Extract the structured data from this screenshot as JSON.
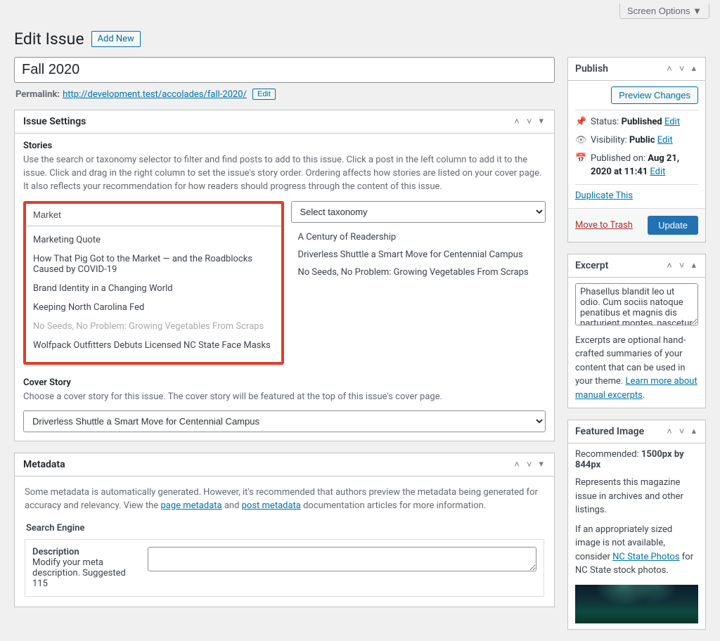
{
  "screen_options_label": "Screen Options ▼",
  "page_title": "Edit Issue",
  "add_new_label": "Add New",
  "title_value": "Fall 2020",
  "permalink": {
    "label": "Permalink:",
    "url": "http://development.test/accolades/fall-2020/",
    "edit_label": "Edit"
  },
  "issue_settings": {
    "heading": "Issue Settings",
    "stories_label": "Stories",
    "stories_help": "Use the search or taxonomy selector to filter and find posts to add to this issue. Click a post in the left column to add it to the issue. Click and drag in the right column to set the issue's story order. Ordering affects how stories are listed on your cover page. It also reflects your recommendation for how readers should progress through the content of this issue.",
    "search_value": "Market",
    "results": [
      {
        "title": "Marketing Quote",
        "muted": false
      },
      {
        "title": "How That Pig Got to the Market — and the Roadblocks Caused by COVID-19",
        "muted": false
      },
      {
        "title": "Brand Identity in a Changing World",
        "muted": false
      },
      {
        "title": "Keeping North Carolina Fed",
        "muted": false
      },
      {
        "title": "No Seeds, No Problem: Growing Vegetables From Scraps",
        "muted": true
      },
      {
        "title": "Wolfpack Outfitters Debuts Licensed NC State Face Masks",
        "muted": false
      }
    ],
    "taxonomy_placeholder": "Select taxonomy",
    "added_stories": [
      "A Century of Readership",
      "Driverless Shuttle a Smart Move for Centennial Campus",
      "No Seeds, No Problem: Growing Vegetables From Scraps"
    ],
    "cover_label": "Cover Story",
    "cover_help": "Choose a cover story for this issue. The cover story will be featured at the top of this issue's cover page.",
    "cover_value": "Driverless Shuttle a Smart Move for Centennial Campus"
  },
  "metadata": {
    "heading": "Metadata",
    "intro_a": "Some metadata is automatically generated. However, it's recommended that authors preview the metadata being generated for accuracy and relevancy. View the ",
    "link1": "page metadata",
    "intro_b": " and ",
    "link2": "post metadata",
    "intro_c": " documentation articles for more information.",
    "se_heading": "Search Engine",
    "desc_label": "Description",
    "desc_help": "Modify your meta description. Suggested 115"
  },
  "publish": {
    "heading": "Publish",
    "preview_label": "Preview Changes",
    "status_label": "Status:",
    "status_value": "Published",
    "visibility_label": "Visibility:",
    "visibility_value": "Public",
    "published_label": "Published on:",
    "published_value": "Aug 21, 2020 at 11:41",
    "edit_label": "Edit",
    "duplicate_label": "Duplicate This",
    "trash_label": "Move to Trash",
    "update_label": "Update"
  },
  "excerpt": {
    "heading": "Excerpt",
    "value": "Phasellus blandit leo ut odio. Cum sociis natoque penatibus et magnis dis parturient montes, nascetur",
    "help_a": "Excerpts are optional hand-crafted summaries of your content that can be used in your theme. ",
    "help_link": "Learn more about manual excerpts",
    "help_b": "."
  },
  "featured": {
    "heading": "Featured Image",
    "rec_label": "Recommended: ",
    "rec_value": "1500px by 844px",
    "line1": "Represents this magazine issue in archives and other listings.",
    "line2a": "If an appropriately sized image is not available, consider ",
    "link": "NC State Photos",
    "line2b": " for NC State stock photos."
  }
}
